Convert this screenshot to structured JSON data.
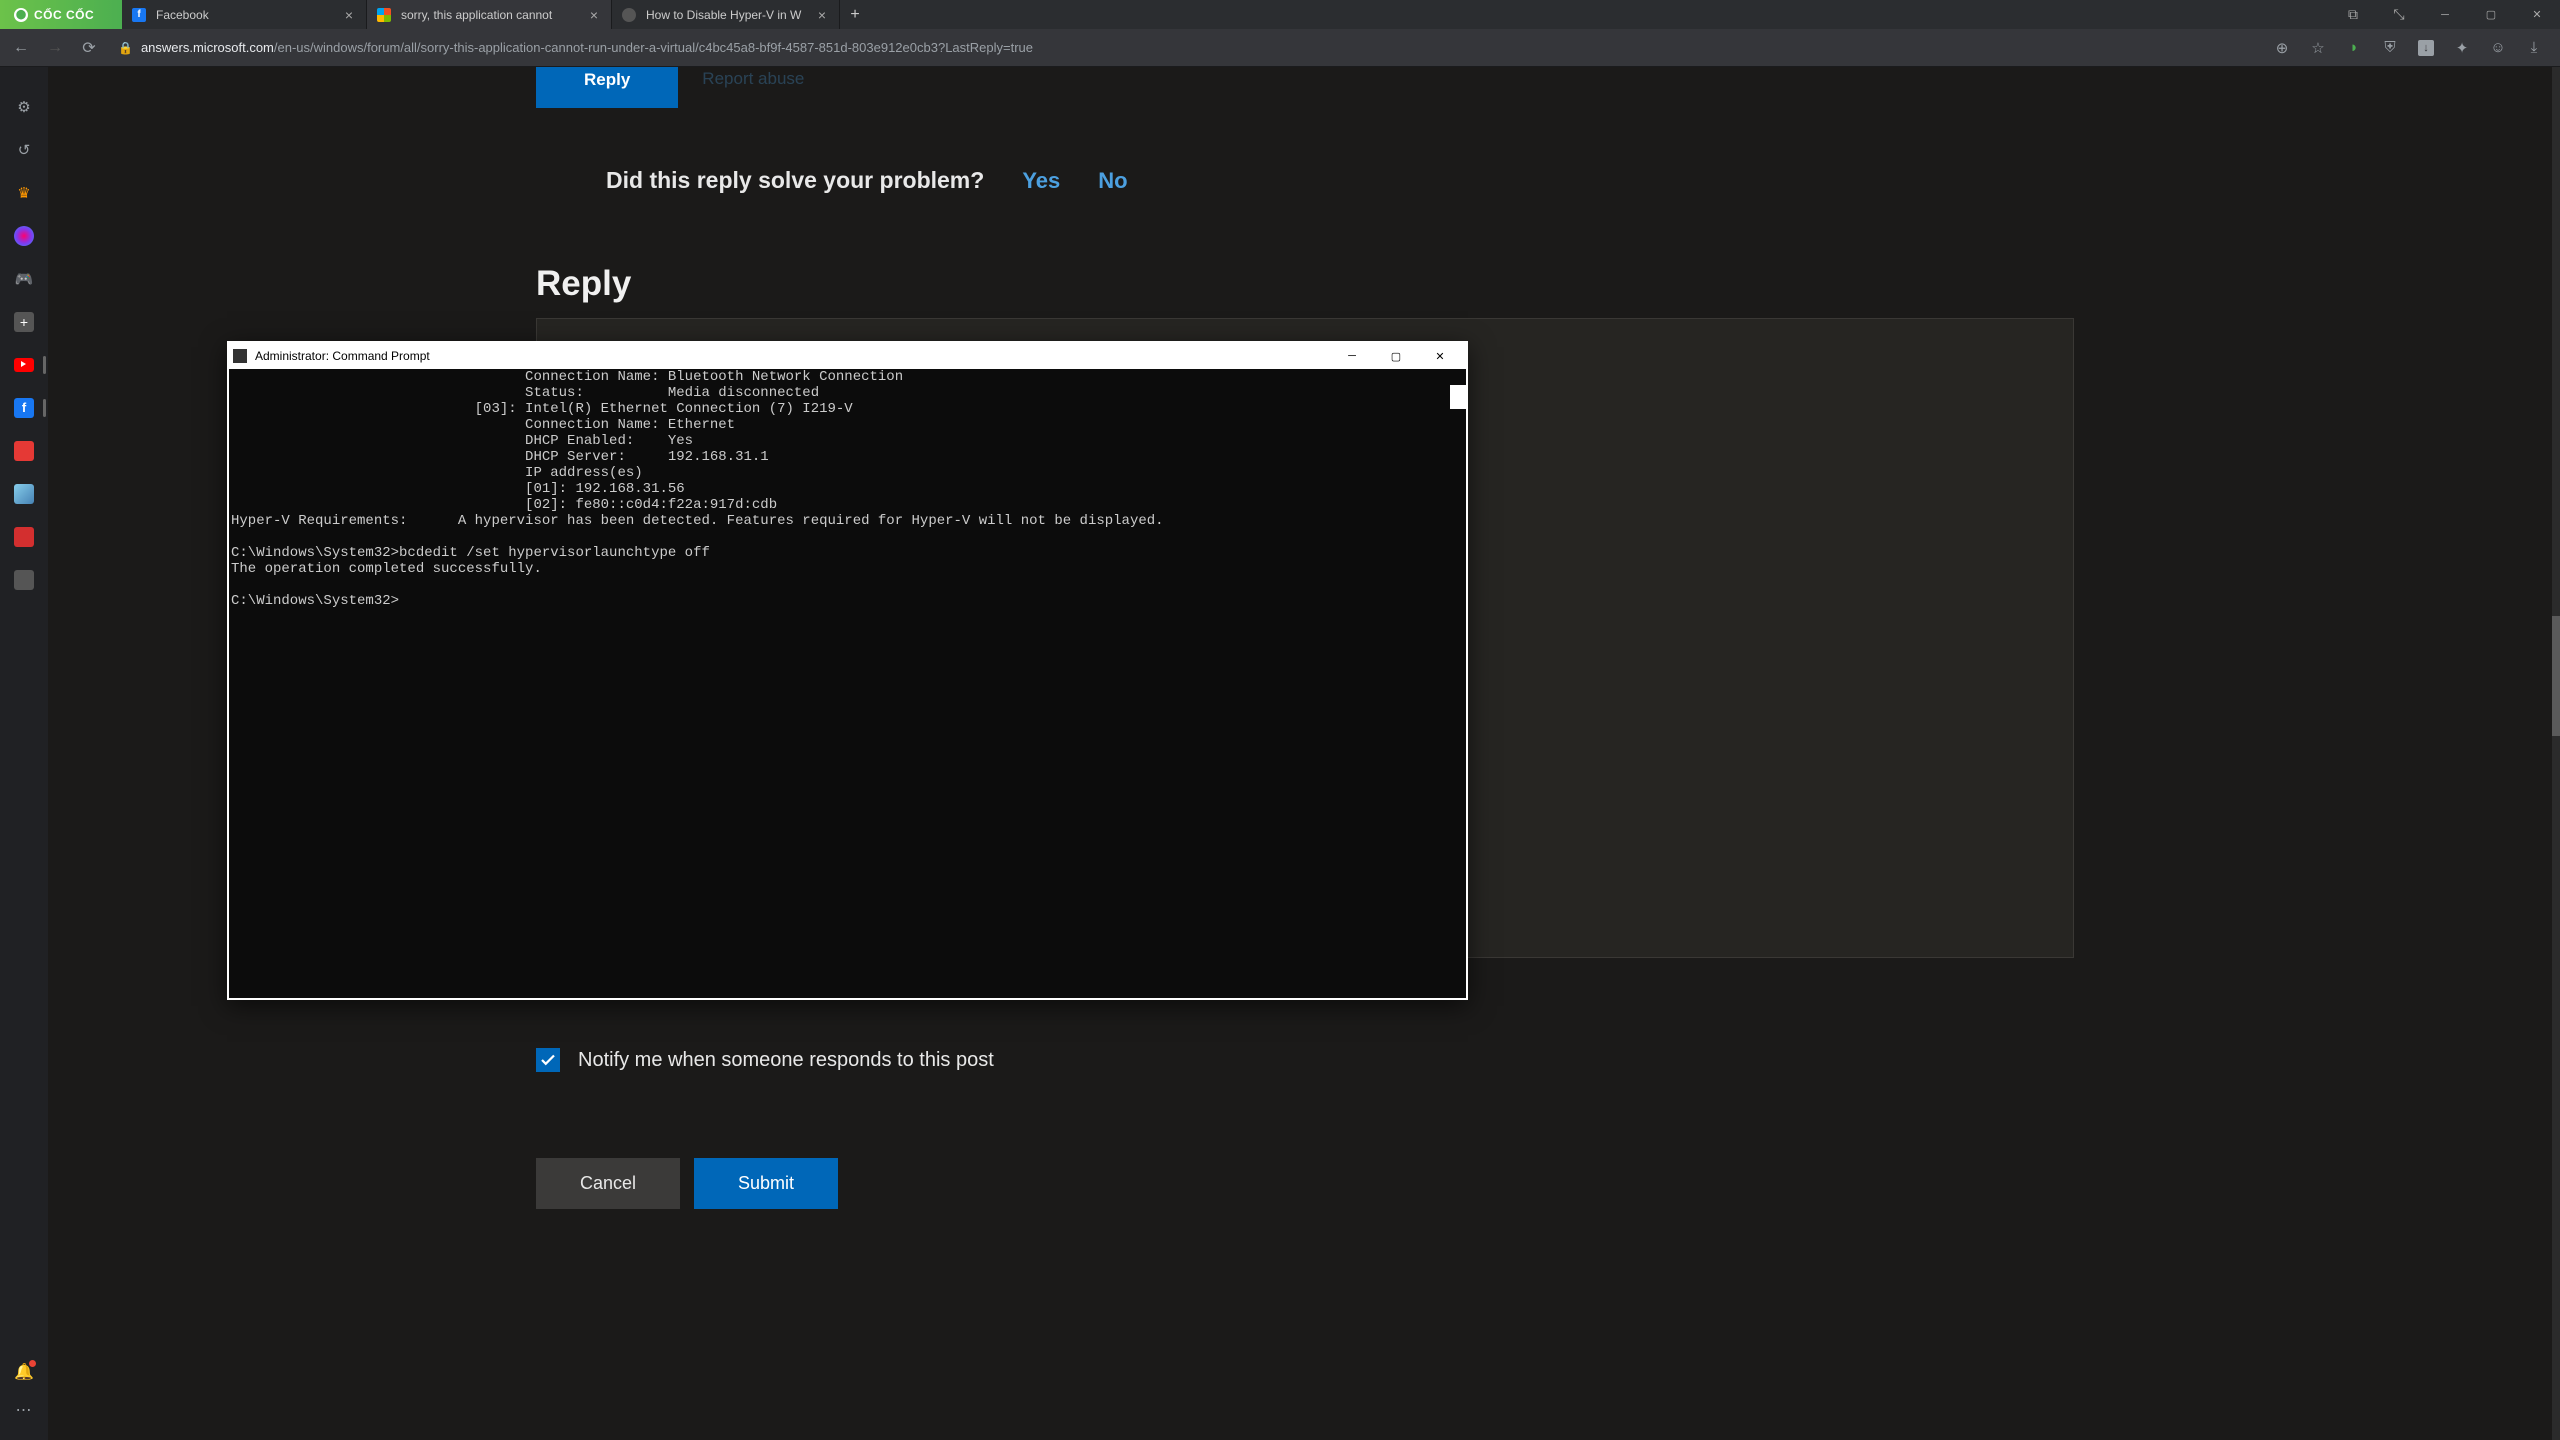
{
  "browser": {
    "logo": "CỐC CỐC",
    "tabs": [
      {
        "title": "Facebook",
        "icon": "fb"
      },
      {
        "title": "sorry, this application cannot",
        "icon": "ms",
        "active": true
      },
      {
        "title": "How to Disable Hyper-V in W",
        "icon": "m"
      }
    ],
    "url_host": "answers.microsoft.com",
    "url_path": "/en-us/windows/forum/all/sorry-this-application-cannot-run-under-a-virtual/c4bc45a8-bf9f-4587-851d-803e912e0cb3?LastReply=true"
  },
  "page": {
    "reply_button": "Reply",
    "report_link": "Report abuse",
    "feedback_question": "Did this reply solve your problem?",
    "yes": "Yes",
    "no": "No",
    "reply_heading": "Reply",
    "notify_label": "Notify me when someone responds to this post",
    "cancel": "Cancel",
    "submit": "Submit"
  },
  "cmd": {
    "title": "Administrator: Command Prompt",
    "lines": [
      "                                   Connection Name: Bluetooth Network Connection",
      "                                   Status:          Media disconnected",
      "                             [03]: Intel(R) Ethernet Connection (7) I219-V",
      "                                   Connection Name: Ethernet",
      "                                   DHCP Enabled:    Yes",
      "                                   DHCP Server:     192.168.31.1",
      "                                   IP address(es)",
      "                                   [01]: 192.168.31.56",
      "                                   [02]: fe80::c0d4:f22a:917d:cdb",
      "Hyper-V Requirements:      A hypervisor has been detected. Features required for Hyper-V will not be displayed.",
      "",
      "C:\\Windows\\System32>bcdedit /set hypervisorlaunchtype off",
      "The operation completed successfully.",
      "",
      "C:\\Windows\\System32>"
    ]
  }
}
